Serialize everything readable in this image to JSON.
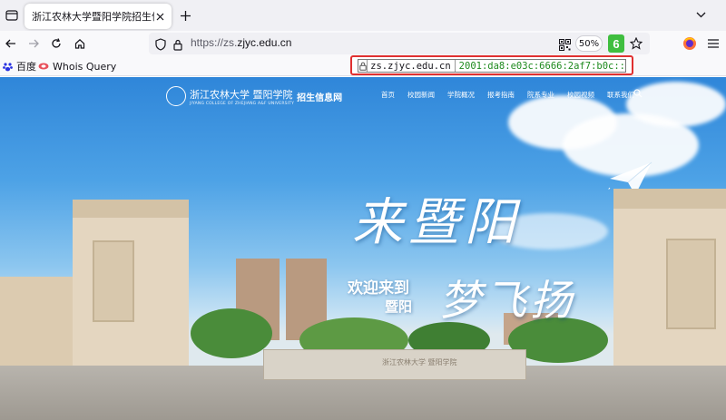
{
  "browser": {
    "tab_title": "浙江农林大学暨阳学院招生信息网",
    "url_prefix": "https://zs.",
    "url_host": "zjyc.edu.cn",
    "zoom": "50%",
    "extension_badge": "6"
  },
  "bookmarks": [
    {
      "label": "百度"
    },
    {
      "label": "Whois Query"
    }
  ],
  "ip_overlay": {
    "domain": "zs.zjyc.edu.cn",
    "address": "2001:da8:e03c:6666:2af7:b0c::"
  },
  "site": {
    "logo_cn": "浙江农林大学 暨阳学院",
    "logo_en": "JIYANG COLLEGE OF ZHEJIANG A&F UNIVERSITY",
    "logo_sub": "招生信息网",
    "menu": [
      "首页",
      "校园新闻",
      "学院概况",
      "报考指南",
      "院系专业",
      "校园视频",
      "联系我们"
    ],
    "hero_title": "来暨阳",
    "hero_line1": "欢迎来到",
    "hero_line2": "暨阳",
    "hero_slogan": "梦飞扬",
    "stone_text": "浙江农林大学  暨阳学院"
  },
  "colors": {
    "accent_green": "#3fbe3f",
    "highlight_red": "#e03030",
    "sky_blue": "#2f86d9"
  }
}
